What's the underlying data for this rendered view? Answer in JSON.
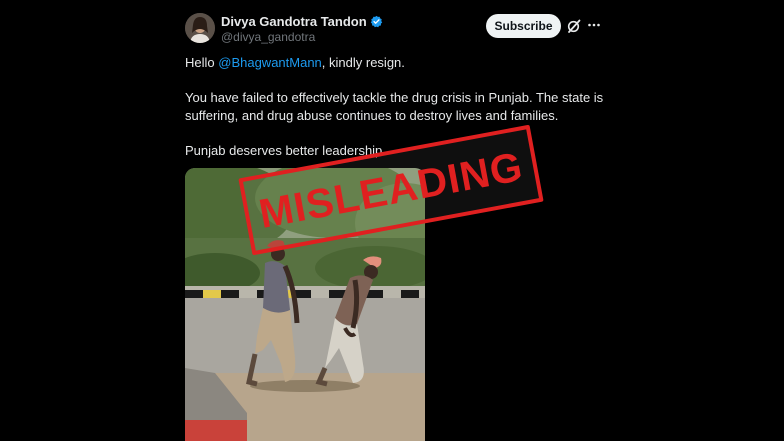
{
  "author": {
    "display_name": "Divya Gandotra Tandon",
    "handle": "@divya_gandotra",
    "verified": true
  },
  "actions": {
    "subscribe_label": "Subscribe",
    "grok_icon": "grok-icon",
    "more_icon": "more-horizontal-icon"
  },
  "tweet": {
    "greeting_prefix": "Hello ",
    "mention": "@BhagwantMann",
    "greeting_suffix": ", kindly resign.",
    "paragraph_line_1": "You have failed to effectively tackle the drug crisis in Punjab. The state is",
    "paragraph_line_2": "suffering, and drug abuse continues to destroy lives and families.",
    "closing": "Punjab deserves better leadership."
  },
  "overlay": {
    "stamp_text": "MISLEADING",
    "stamp_color": "#e02020"
  },
  "colors": {
    "background": "#000000",
    "text": "#e7e9ea",
    "secondary_text": "#71767b",
    "link": "#1d9bf0",
    "verified_badge": "#1d9bf0"
  }
}
